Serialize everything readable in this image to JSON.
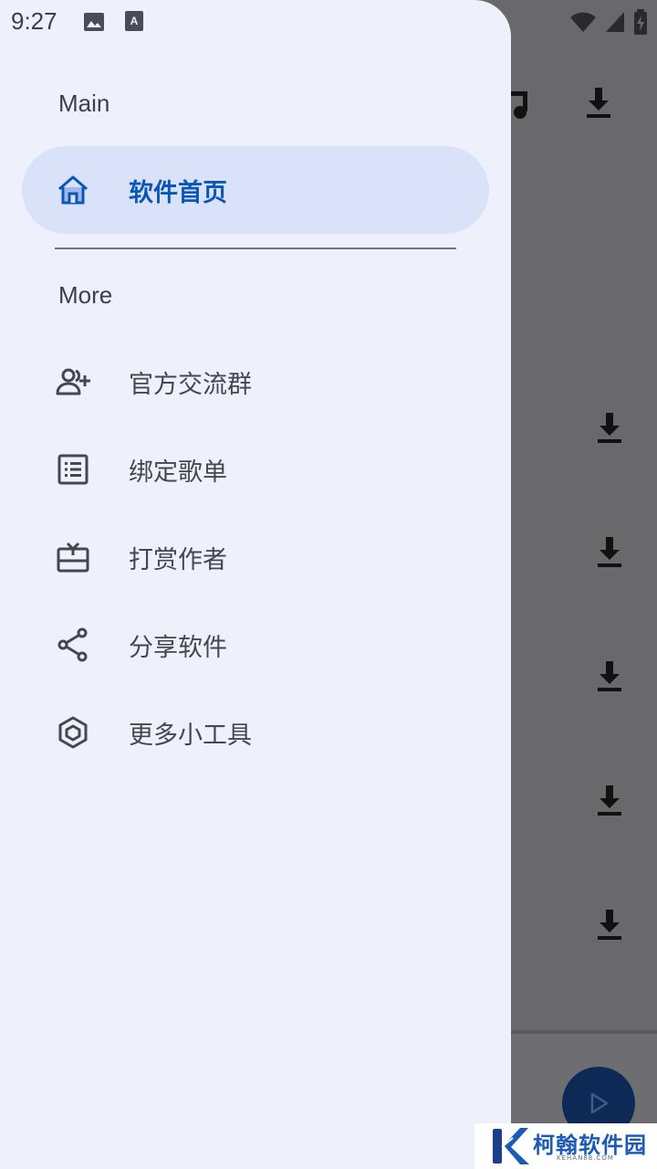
{
  "status_bar": {
    "time": "9:27"
  },
  "drawer": {
    "main_section": "Main",
    "more_section": "More",
    "items": [
      {
        "label": "软件首页",
        "icon": "home-icon",
        "active": true
      },
      {
        "label": "官方交流群",
        "icon": "add-person-icon"
      },
      {
        "label": "绑定歌单",
        "icon": "list-icon"
      },
      {
        "label": "打赏作者",
        "icon": "gift-card-icon"
      },
      {
        "label": "分享软件",
        "icon": "share-icon"
      },
      {
        "label": "更多小工具",
        "icon": "cube-icon"
      }
    ]
  },
  "watermark": {
    "brand": "柯翰软件园",
    "domain": "KEHAN88.COM"
  },
  "colors": {
    "drawer_bg": "#eef1fb",
    "active_bg": "#d9e2f8",
    "active_text": "#0b57b8",
    "scrim": "#6b6b6e"
  }
}
